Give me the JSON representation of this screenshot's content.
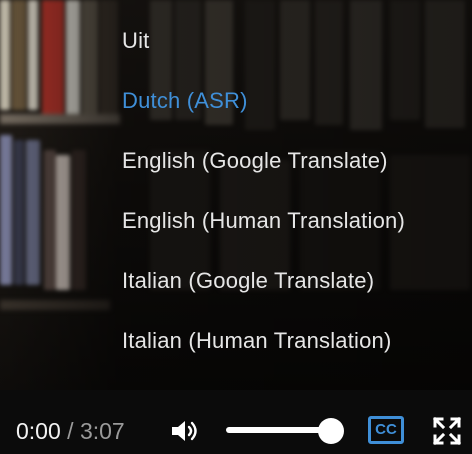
{
  "captions_menu": {
    "items": [
      {
        "label": "Uit",
        "selected": false
      },
      {
        "label": "Dutch (ASR)",
        "selected": true
      },
      {
        "label": "English (Google Translate)",
        "selected": false
      },
      {
        "label": "English (Human Translation)",
        "selected": false
      },
      {
        "label": "Italian (Google Translate)",
        "selected": false
      },
      {
        "label": "Italian (Human Translation)",
        "selected": false
      }
    ]
  },
  "controls": {
    "current_time": "0:00",
    "separator": "/",
    "duration": "3:07",
    "volume_level": 1.0,
    "captions_label": "CC",
    "icons": [
      "volume-icon",
      "captions-icon",
      "fullscreen-icon"
    ]
  },
  "colors": {
    "accent": "#3f8fd8",
    "menu_text": "#e6e6e6",
    "control_bar": "#0b0b0b"
  }
}
